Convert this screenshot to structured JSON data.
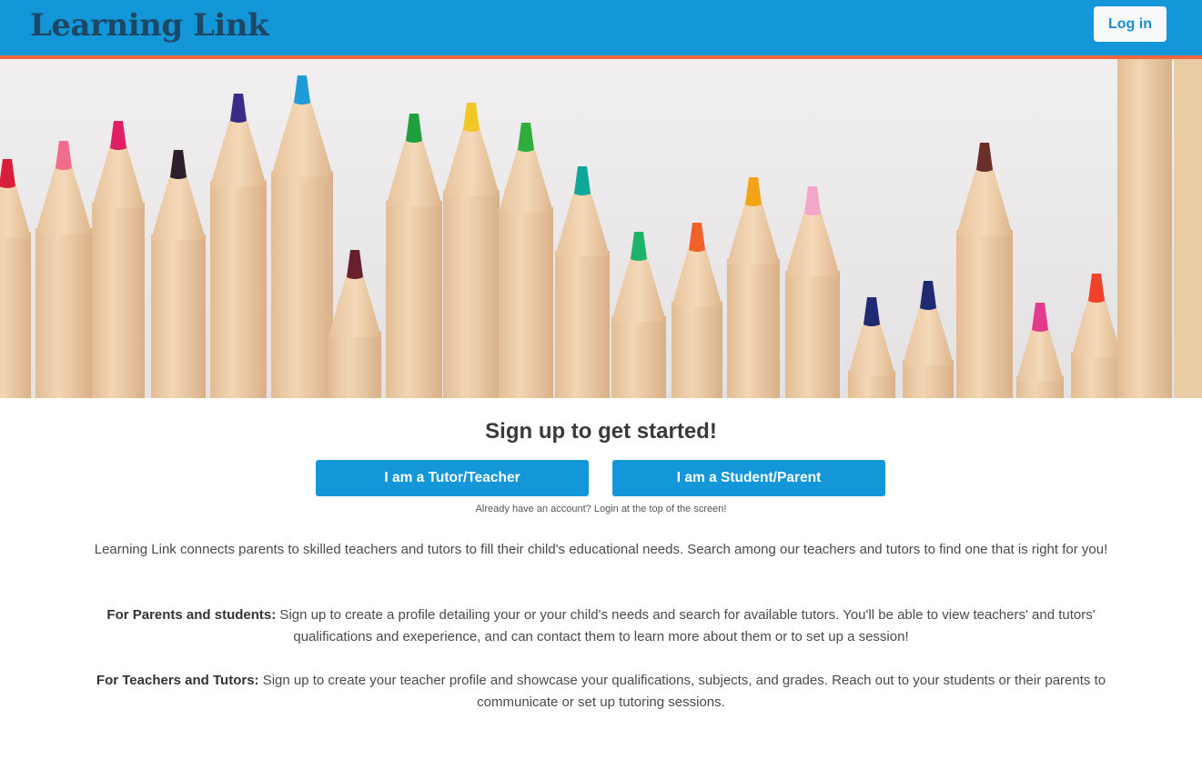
{
  "header": {
    "brand": "Learning Link",
    "login_label": "Log in"
  },
  "hero": {
    "icon": "colored-pencils-banner",
    "pencil_tip_colors": [
      "#d81e3b",
      "#f26d8b",
      "#e01f67",
      "#2d1f2a",
      "#3b2a88",
      "#66202e",
      "#1f9bd8",
      "#1f9f3d",
      "#f0c825",
      "#2fae3e",
      "#0ea79a",
      "#1db36b",
      "#f0622a",
      "#f3a416",
      "#f3a6c8",
      "#1f2a73",
      "#6a2f2a",
      "#e23a8c",
      "#f0422a"
    ]
  },
  "signup": {
    "title": "Sign up to get started!",
    "tutor_button": "I am a Tutor/Teacher",
    "student_button": "I am a Student/Parent",
    "already_text": "Already have an account? Login at the top of the screen!"
  },
  "info": {
    "intro": "Learning Link connects parents to skilled teachers and tutors to fill their child's educational needs. Search among our teachers and tutors to find one that is right for you!",
    "parents_label": "For Parents and students:",
    "parents_text": " Sign up to create a profile detailing your or your child's needs and search for available tutors. You'll be able to view teachers' and tutors' qualifications and exeperience, and can contact them to learn more about them or to set up a session!",
    "teachers_label": "For Teachers and Tutors:",
    "teachers_text": " Sign up to create your teacher profile and showcase your qualifications, subjects, and grades. Reach out to your students or their parents to communicate or set up tutoring sessions."
  }
}
